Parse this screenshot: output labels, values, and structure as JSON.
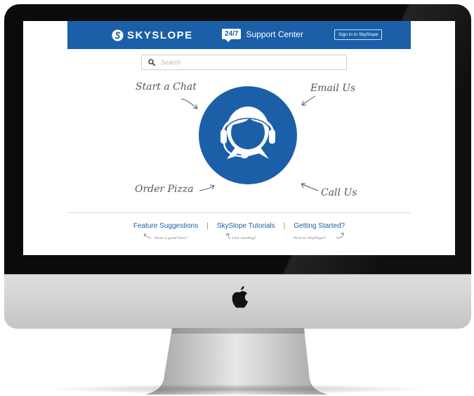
{
  "header": {
    "brand": "SKYSLOPE",
    "badge": "24/7",
    "support_label": "Support Center",
    "signin_label": "Sign in to SkySlope"
  },
  "search": {
    "placeholder": "Search"
  },
  "options": {
    "chat": "Start a Chat",
    "email": "Email Us",
    "pizza": "Order Pizza",
    "call": "Call Us"
  },
  "footer": {
    "links": [
      {
        "label": "Feature Suggestions",
        "note": "Have a good idea?"
      },
      {
        "label": "SkySlope Tutorials",
        "note": "Like reading?"
      },
      {
        "label": "Getting Started?",
        "note": "New to SkySlope?"
      }
    ],
    "separator": "|"
  },
  "colors": {
    "brand_blue": "#1b5fa8",
    "bezel": "#0b0b0b",
    "chin": "#d6d6d6"
  },
  "icons": [
    "skyslope-logo-icon",
    "search-icon",
    "headset-agent-icon",
    "arrow-icon",
    "apple-logo-icon"
  ]
}
